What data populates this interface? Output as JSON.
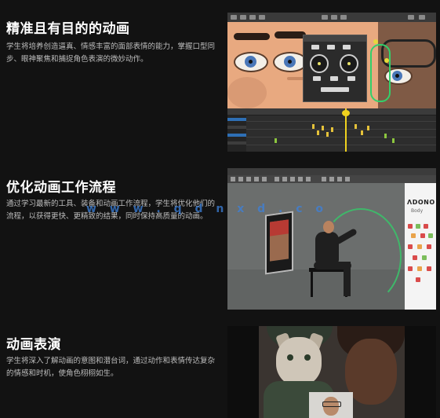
{
  "sections": [
    {
      "title": "精准且有目的的动画",
      "description": "学生将培养创造逼真、情感丰富的面部表情的能力，掌握口型同步、眼神聚焦和捕捉角色表演的微妙动作。"
    },
    {
      "title": "优化动画工作流程",
      "description": "通过学习最新的工具、装备和动画工作流程，学生将优化他们的流程，以获得更快、更精致的结果，同时保持高质量的动画。"
    },
    {
      "title": "动画表演",
      "description": "学生将深入了解动画的意图和潜台词，通过动作和表情传达复杂的情感和时机，使角色栩栩如生。"
    }
  ],
  "watermark": "w w w . q d n x d . c o",
  "panel_logo": "ΛDONO",
  "panel_sub": "Body",
  "colors": {
    "background": "#121212",
    "accent_green": "#33d06b",
    "playhead": "#f0d21e",
    "track_blue": "#2e6fb5"
  }
}
